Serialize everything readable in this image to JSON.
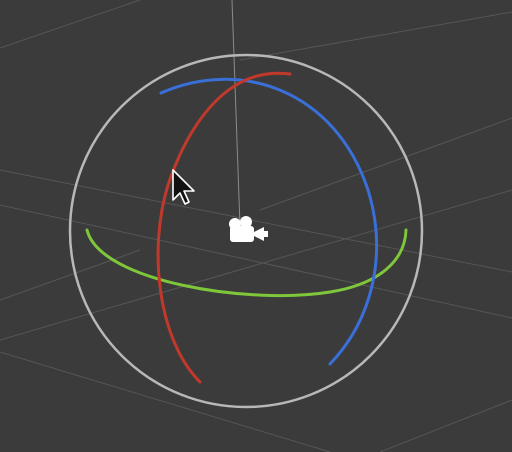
{
  "viewport": {
    "name": "3D viewport",
    "background": "#3b3b3b",
    "grid_color": "#565656"
  },
  "gizmo": {
    "type": "rotate",
    "outer_ring_color": "#b8b8b8",
    "rings": [
      {
        "axis": "X",
        "color": "#c0392b"
      },
      {
        "axis": "Y",
        "color": "#7ec63a"
      },
      {
        "axis": "Z",
        "color": "#3a6fd8"
      }
    ]
  },
  "center_object": {
    "icon": "video-camera-icon",
    "color": "#ffffff"
  },
  "cursor": {
    "icon": "arrow-cursor-icon"
  }
}
